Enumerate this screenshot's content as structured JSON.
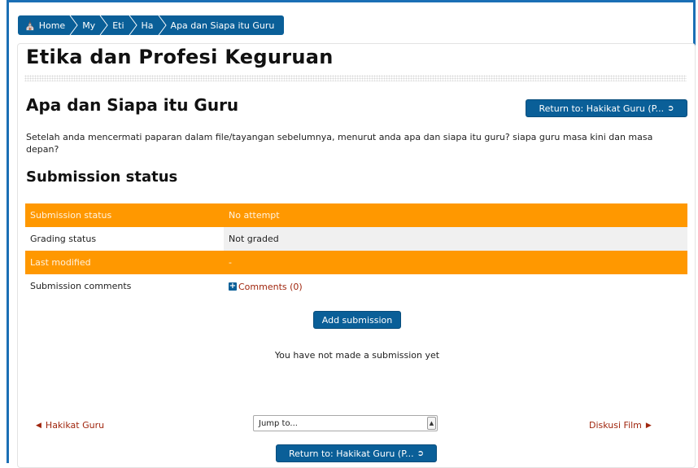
{
  "breadcrumb": {
    "home": "Home",
    "items": [
      "My",
      "Eti",
      "Ha",
      "Apa dan Siapa itu Guru"
    ]
  },
  "course_title": "Etika dan Profesi Keguruan",
  "activity_title": "Apa dan Siapa itu Guru",
  "return_button_label": "Return to: Hakikat Guru (P...",
  "intro_text": "Setelah anda mencermati paparan dalam file/tayangan sebelumnya, menurut anda apa dan siapa itu guru? siapa guru masa kini dan masa depan?",
  "submission_section_title": "Submission status",
  "status_rows": [
    {
      "label": "Submission status",
      "value": "No attempt"
    },
    {
      "label": "Grading status",
      "value": "Not graded"
    },
    {
      "label": "Last modified",
      "value": "-"
    },
    {
      "label": "Submission comments",
      "value": "Comments (0)"
    }
  ],
  "add_submission_label": "Add submission",
  "no_submission_text": "You have not made a submission yet",
  "nav": {
    "prev_label": "Hakikat Guru",
    "next_label": "Diskusi Film",
    "jump_placeholder": "Jump to..."
  },
  "colors": {
    "primary": "#0a5f98",
    "highlight_row": "#ff9800",
    "link": "#a0260e",
    "frame": "#1b6fb5"
  },
  "icons": {
    "home": "home-icon",
    "door": "sign-in-icon",
    "plus": "plus-square-icon",
    "prev": "triangle-left-icon",
    "next": "triangle-right-icon"
  }
}
